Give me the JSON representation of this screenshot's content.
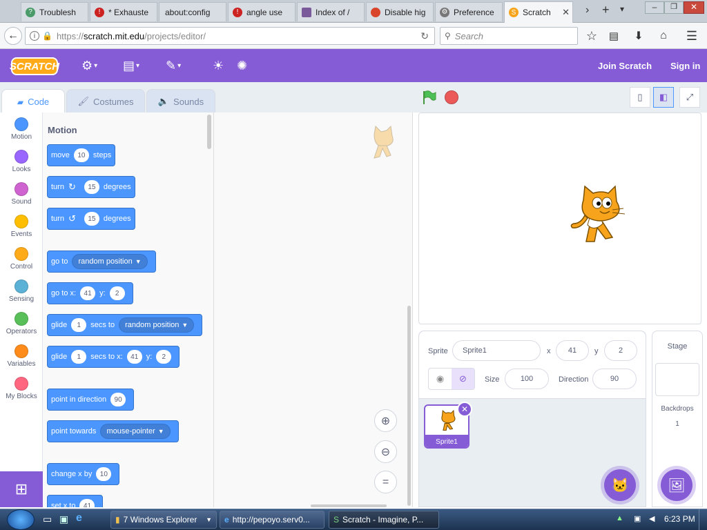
{
  "browser": {
    "tabs": [
      {
        "label": "Troublesh",
        "icon": "help-icon",
        "color": "#4a9a6a"
      },
      {
        "label": "* Exhauste",
        "icon": "opera-icon",
        "color": "#cc2222"
      },
      {
        "label": "about:config",
        "icon": "blank-icon",
        "color": "#dddddd"
      },
      {
        "label": "angle use",
        "icon": "opera-icon",
        "color": "#cc2222"
      },
      {
        "label": "Index of /",
        "icon": "image-icon",
        "color": "#7a5a9a"
      },
      {
        "label": "Disable hig",
        "icon": "firefox-icon",
        "color": "#d9452a"
      },
      {
        "label": "Preference",
        "icon": "gear-icon",
        "color": "#777777"
      },
      {
        "label": "Scratch",
        "icon": "scratch-icon",
        "color": "#f7a41c"
      }
    ],
    "url_prefix": "https://",
    "url_domain": "scratch.mit.edu",
    "url_path": "/projects/editor/",
    "search_placeholder": "Search"
  },
  "menu": {
    "logo": "SCRATCH",
    "join": "Join Scratch",
    "signin": "Sign in"
  },
  "editor_tabs": [
    "Code",
    "Costumes",
    "Sounds"
  ],
  "categories": [
    {
      "label": "Motion",
      "color": "#4c97ff"
    },
    {
      "label": "Looks",
      "color": "#9966ff"
    },
    {
      "label": "Sound",
      "color": "#cf63cf"
    },
    {
      "label": "Events",
      "color": "#ffbf00"
    },
    {
      "label": "Control",
      "color": "#ffab19"
    },
    {
      "label": "Sensing",
      "color": "#5cb1d6"
    },
    {
      "label": "Operators",
      "color": "#59c059"
    },
    {
      "label": "Variables",
      "color": "#ff8c1a"
    },
    {
      "label": "My Blocks",
      "color": "#ff6680"
    }
  ],
  "palette": {
    "heading": "Motion",
    "move": {
      "a": "move",
      "v": "10",
      "b": "steps"
    },
    "turn_right": {
      "a": "turn",
      "v": "15",
      "b": "degrees"
    },
    "turn_left": {
      "a": "turn",
      "v": "15",
      "b": "degrees"
    },
    "goto": {
      "a": "go to",
      "dd": "random position"
    },
    "gotoxy": {
      "a": "go to x:",
      "x": "41",
      "b": "y:",
      "y": "2"
    },
    "glide_to": {
      "a": "glide",
      "v": "1",
      "b": "secs to",
      "dd": "random position"
    },
    "glide_xy": {
      "a": "glide",
      "v": "1",
      "b": "secs to x:",
      "x": "41",
      "c": "y:",
      "y": "2"
    },
    "point_dir": {
      "a": "point in direction",
      "v": "90"
    },
    "point_towards": {
      "a": "point towards",
      "dd": "mouse-pointer"
    },
    "change_x": {
      "a": "change x by",
      "v": "10"
    },
    "set_x": {
      "a": "set x to",
      "v": "41"
    }
  },
  "sprite": {
    "sprite_label": "Sprite",
    "name": "Sprite1",
    "x_label": "x",
    "x": "41",
    "y_label": "y",
    "y": "2",
    "size_label": "Size",
    "size": "100",
    "direction_label": "Direction",
    "direction": "90",
    "thumb_label": "Sprite1"
  },
  "stage_pane": {
    "title": "Stage",
    "backdrops_label": "Backdrops",
    "backdrops_count": "1"
  },
  "taskbar": {
    "explorer": "7 Windows Explorer",
    "browser": "http://pepoyo.serv0...",
    "scratch": "Scratch - Imagine, P...",
    "time": "6:23 PM"
  }
}
